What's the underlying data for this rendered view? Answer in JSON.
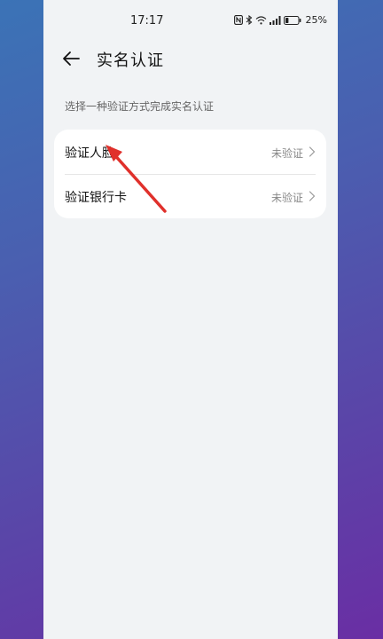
{
  "status_bar": {
    "time": "17:17",
    "battery_percent": "25%",
    "battery_level": 0.25
  },
  "header": {
    "title": "实名认证"
  },
  "subtitle": "选择一种验证方式完成实名认证",
  "options": [
    {
      "label": "验证人脸",
      "status": "未验证"
    },
    {
      "label": "验证银行卡",
      "status": "未验证"
    }
  ],
  "colors": {
    "annotation_arrow": "#e0302b",
    "page_background": "#f1f3f5"
  },
  "icons": {
    "back": "arrow-left-icon",
    "chevron": "chevron-right-icon",
    "nfc": "nfc-icon",
    "bluetooth": "bluetooth-icon",
    "wifi": "wifi-icon",
    "signal": "signal-icon",
    "battery": "battery-icon"
  }
}
